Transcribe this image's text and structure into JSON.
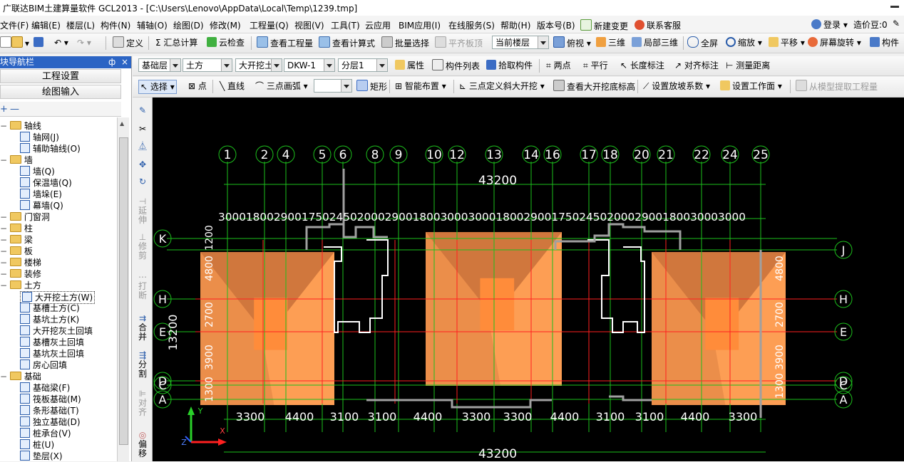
{
  "window": {
    "title": "广联达BIM土建算量软件 GCL2013 - [C:\\Users\\Lenovo\\AppData\\Local\\Temp\\1239.tmp]"
  },
  "menu": {
    "items": [
      "文件(F)",
      "编辑(E)",
      "楼层(L)",
      "构件(N)",
      "辅轴(O)",
      "绘图(D)",
      "修改(M)",
      "工程量(Q)",
      "视图(V)",
      "工具(T)",
      "云应用",
      "BIM应用(I)",
      "在线服务(S)",
      "帮助(H)",
      "版本号(B)"
    ],
    "new_change": "新建变更",
    "contact": "联系客服",
    "login": "登录",
    "price_beans": "造价豆:0"
  },
  "toolbar1": {
    "define": "定义",
    "sum_calc": "汇总计算",
    "cloud_check": "云检查",
    "view_quantity": "查看工程量",
    "view_formula": "查看计算式",
    "batch_select": "批量选择",
    "level_plate": "平齐板顶",
    "floor_select": "当前楼层",
    "top_view": "俯视",
    "three_d": "三维",
    "local_3d": "局部三维",
    "full_screen": "全屏",
    "zoom": "缩放",
    "pan": "平移",
    "rotate": "屏幕旋转",
    "component": "构件"
  },
  "toolbar2": {
    "layer": "基础层",
    "category": "土方",
    "type": "大开挖土",
    "code": "DKW-1",
    "sublayer": "分层1",
    "properties": "属性",
    "component_list": "构件列表",
    "pick_component": "拾取构件",
    "two_points": "两点",
    "parallel": "平行",
    "length_mark": "长度标注",
    "align_mark": "对齐标注",
    "measure": "测量距离"
  },
  "toolbar3": {
    "select": "选择",
    "point": "点",
    "line": "直线",
    "arc": "三点画弧",
    "rect": "矩形",
    "smart_layout": "智能布置",
    "three_point_slope": "三点定义斜大开挖",
    "view_bottom": "查看大开挖底标高",
    "set_slope": "设置放坡系数",
    "set_face": "设置工作面",
    "extract": "从模型提取工程量"
  },
  "nav": {
    "title": "块导航栏",
    "pin": "ф",
    "close": "×",
    "project_settings": "工程设置",
    "drawing_input": "绘图输入",
    "tree": [
      {
        "label": "轴线",
        "level": 0,
        "type": "folder"
      },
      {
        "label": "轴网(J)",
        "level": 1,
        "type": "leaf"
      },
      {
        "label": "辅助轴线(O)",
        "level": 1,
        "type": "leaf"
      },
      {
        "label": "墙",
        "level": 0,
        "type": "folder"
      },
      {
        "label": "墙(Q)",
        "level": 1,
        "type": "leaf"
      },
      {
        "label": "保温墙(Q)",
        "level": 1,
        "type": "leaf"
      },
      {
        "label": "墙垛(E)",
        "level": 1,
        "type": "leaf"
      },
      {
        "label": "幕墙(Q)",
        "level": 1,
        "type": "leaf"
      },
      {
        "label": "门窗洞",
        "level": 0,
        "type": "folder"
      },
      {
        "label": "柱",
        "level": 0,
        "type": "folder"
      },
      {
        "label": "梁",
        "level": 0,
        "type": "folder"
      },
      {
        "label": "板",
        "level": 0,
        "type": "folder"
      },
      {
        "label": "楼梯",
        "level": 0,
        "type": "folder"
      },
      {
        "label": "装修",
        "level": 0,
        "type": "folder"
      },
      {
        "label": "土方",
        "level": 0,
        "type": "folder"
      },
      {
        "label": "大开挖土方(W)",
        "level": 1,
        "type": "leaf",
        "selected": true
      },
      {
        "label": "基槽土方(C)",
        "level": 1,
        "type": "leaf"
      },
      {
        "label": "基坑土方(K)",
        "level": 1,
        "type": "leaf"
      },
      {
        "label": "大开挖灰土回填",
        "level": 1,
        "type": "leaf"
      },
      {
        "label": "基槽灰土回填",
        "level": 1,
        "type": "leaf"
      },
      {
        "label": "基坑灰土回填",
        "level": 1,
        "type": "leaf"
      },
      {
        "label": "房心回填",
        "level": 1,
        "type": "leaf"
      },
      {
        "label": "基础",
        "level": 0,
        "type": "folder"
      },
      {
        "label": "基础梁(F)",
        "level": 1,
        "type": "leaf"
      },
      {
        "label": "筏板基础(M)",
        "level": 1,
        "type": "leaf"
      },
      {
        "label": "条形基础(T)",
        "level": 1,
        "type": "leaf"
      },
      {
        "label": "独立基础(D)",
        "level": 1,
        "type": "leaf"
      },
      {
        "label": "桩承台(V)",
        "level": 1,
        "type": "leaf"
      },
      {
        "label": "桩(U)",
        "level": 1,
        "type": "leaf"
      },
      {
        "label": "垫层(X)",
        "level": 1,
        "type": "leaf"
      }
    ]
  },
  "vtools": [
    "延伸",
    "修剪",
    "打断",
    "合并",
    "分割",
    "对齐",
    "偏移"
  ],
  "drawing": {
    "axis_numbers": [
      "1",
      "2",
      "4",
      "5",
      "6",
      "8",
      "9",
      "10",
      "12",
      "13",
      "14",
      "16",
      "17",
      "18",
      "20",
      "21",
      "22",
      "24",
      "25"
    ],
    "row_letters_left": [
      "K",
      "H",
      "E",
      "D",
      "C",
      "A"
    ],
    "row_letters_right": [
      "J",
      "H",
      "E",
      "D",
      "C",
      "A"
    ],
    "total_top": "43200",
    "total_bottom": "43200",
    "top_dims": "3000180029001750245020002900180030003000180029001750245020002900180030003000",
    "bottom_dims": [
      "3300",
      "4400",
      "3100",
      "3100",
      "4400",
      "3300",
      "3300",
      "4400",
      "3100",
      "3100",
      "4400",
      "3300"
    ],
    "left_total": "13200",
    "left_dims": [
      "1200",
      "4800",
      "2700",
      "3900",
      "1300"
    ],
    "right_dims": [
      "4800",
      "2700",
      "3900",
      "1300"
    ],
    "axis_labels": {
      "x": "X",
      "y": "Y",
      "z": "Z"
    },
    "colors": {
      "pit": "#fd9e54",
      "pit_shadow": "#c8703a",
      "pit_light": "#ff8c3a",
      "grid": "#1dbf1d",
      "wall": "#ffffff",
      "red": "#ff2020",
      "gray": "#a0a0a0"
    }
  }
}
